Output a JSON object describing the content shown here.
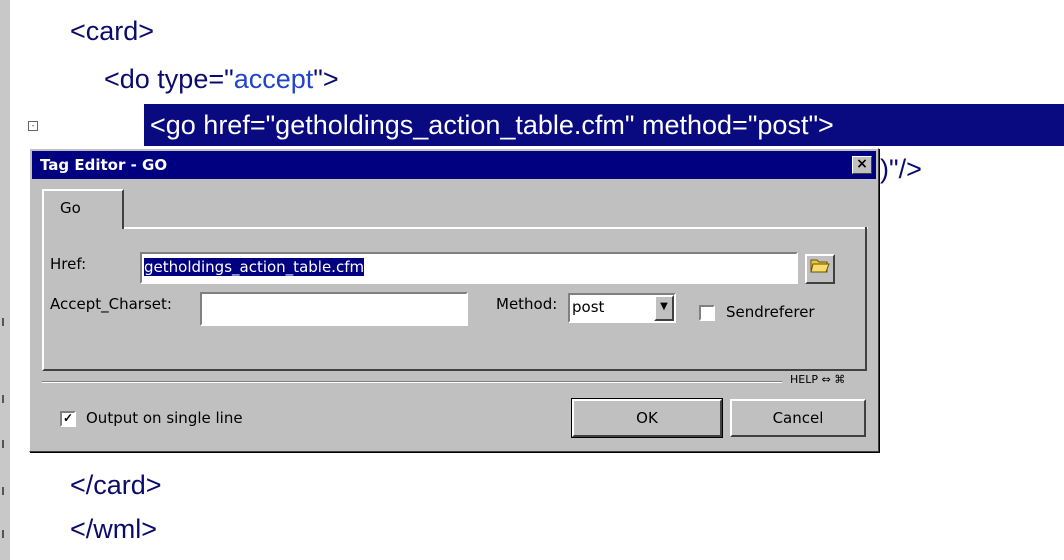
{
  "editor": {
    "lines": {
      "card_open": "<card>",
      "do_prefix": "<do type=\"",
      "do_value": "accept",
      "do_suffix": "\">",
      "go_selected": "<go href=\"getholdings_action_table.cfm\" method=\"post\">",
      "partial_line": ")\"/>",
      "card_close": "</card>",
      "wml_close": "</wml>"
    },
    "fold_marker": "-"
  },
  "dialog": {
    "title": "Tag Editor - GO",
    "close_glyph": "×",
    "tab_label": "Go",
    "href_label": "Href:",
    "href_value": "getholdings_action_table.cfm",
    "browse_icon": "folder-open-icon",
    "accept_charset_label": "Accept_Charset:",
    "accept_charset_value": "",
    "method_label": "Method:",
    "method_value": "post",
    "sendreferer_label": "Sendreferer",
    "sendreferer_checked": false,
    "help_label": "HELP",
    "help_glyphs": "⇔ ⌘",
    "output_single_line_label": "Output on single line",
    "output_single_line_checked": true,
    "ok_label": "OK",
    "cancel_label": "Cancel"
  },
  "colors": {
    "selection": "#0a0a80",
    "titlebar": "#000080",
    "dialog_face": "#c0c0c0",
    "code_text": "#0b0b6e",
    "attr_value": "#2244cc"
  }
}
